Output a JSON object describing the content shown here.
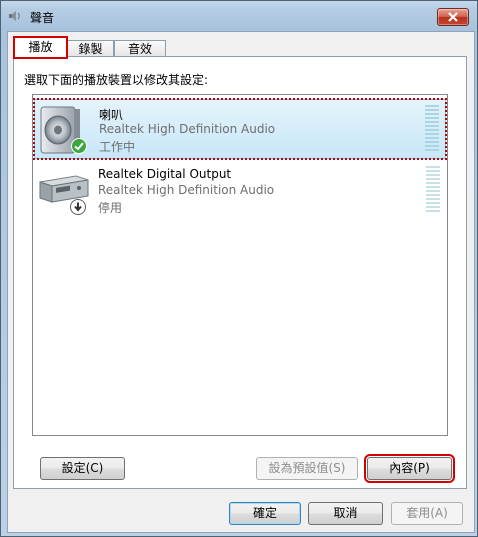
{
  "window": {
    "title": "聲音",
    "close_label": "關閉"
  },
  "tabs": [
    {
      "label": "播放",
      "active": true
    },
    {
      "label": "錄製",
      "active": false
    },
    {
      "label": "音效",
      "active": false
    }
  ],
  "instruction": "選取下面的播放裝置以修改其設定:",
  "devices": [
    {
      "name": "喇叭",
      "driver": "Realtek High Definition Audio",
      "status": "工作中",
      "selected": true,
      "icon": "speaker-icon",
      "badge": "default-check-icon"
    },
    {
      "name": "Realtek Digital Output",
      "driver": "Realtek High Definition Audio",
      "status": "停用",
      "selected": false,
      "icon": "digital-output-icon",
      "badge": "disabled-arrow-icon"
    }
  ],
  "buttons": {
    "configure": "設定(C)",
    "set_default": "設為預設值(S)",
    "properties": "內容(P)",
    "ok": "確定",
    "cancel": "取消",
    "apply": "套用(A)"
  },
  "colors": {
    "highlight": "#d40000",
    "selection": "#c7e7f8",
    "status_ok": "#3da63d"
  }
}
